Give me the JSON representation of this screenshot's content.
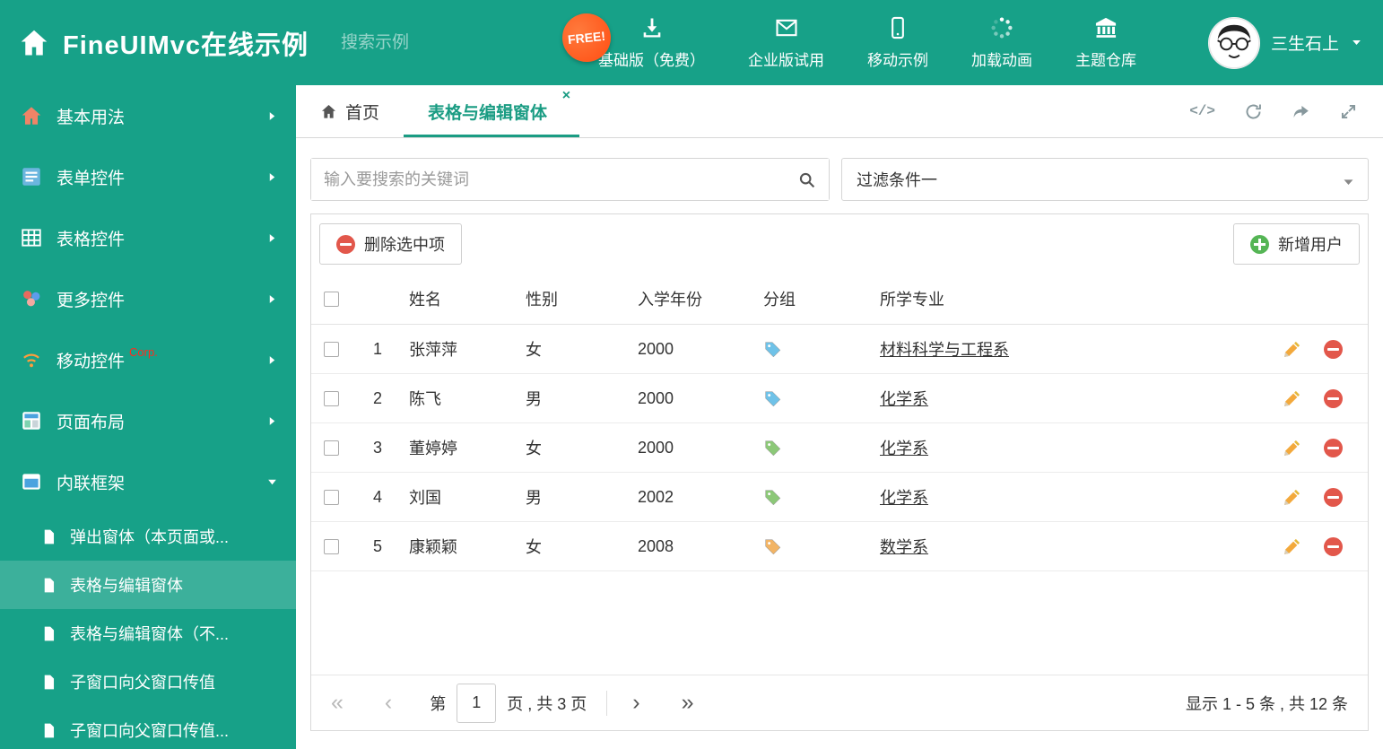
{
  "colors": {
    "accent": "#17a188",
    "badge": "#ff5722",
    "danger": "#e2574b",
    "success": "#55b555",
    "edit": "#f0a63c"
  },
  "header": {
    "title": "FineUIMvc在线示例",
    "search_placeholder": "搜索示例",
    "free_badge": "FREE!",
    "nav": [
      {
        "label": "基础版（免费）",
        "icon": "download-icon"
      },
      {
        "label": "企业版试用",
        "icon": "envelope-icon"
      },
      {
        "label": "移动示例",
        "icon": "mobile-icon"
      },
      {
        "label": "加载动画",
        "icon": "spinner-icon"
      },
      {
        "label": "主题仓库",
        "icon": "bank-icon"
      }
    ],
    "user": {
      "name": "三生石上"
    }
  },
  "sidebar": {
    "items": [
      {
        "label": "基本用法",
        "icon": "home-icon"
      },
      {
        "label": "表单控件",
        "icon": "form-icon"
      },
      {
        "label": "表格控件",
        "icon": "table-icon"
      },
      {
        "label": "更多控件",
        "icon": "widgets-icon"
      },
      {
        "label": "移动控件",
        "badge": "Corp.",
        "icon": "wireless-icon"
      },
      {
        "label": "页面布局",
        "icon": "layout-icon"
      },
      {
        "label": "内联框架",
        "icon": "iframe-icon"
      }
    ],
    "subitems": [
      {
        "label": "弹出窗体（本页面或..."
      },
      {
        "label": "表格与编辑窗体"
      },
      {
        "label": "表格与编辑窗体（不..."
      },
      {
        "label": "子窗口向父窗口传值"
      },
      {
        "label": "子窗口向父窗口传值..."
      }
    ]
  },
  "tabs": {
    "home": "首页",
    "active": "表格与编辑窗体"
  },
  "filter": {
    "search_placeholder": "输入要搜索的关键词",
    "dropdown_value": "过滤条件一"
  },
  "toolbar": {
    "delete_label": "删除选中项",
    "add_label": "新增用户"
  },
  "table": {
    "headers": {
      "name": "姓名",
      "gender": "性别",
      "year": "入学年份",
      "group": "分组",
      "major": "所学专业"
    },
    "rows": [
      {
        "index": "1",
        "name": "张萍萍",
        "gender": "女",
        "year": "2000",
        "tag_color": "#6fc2e8",
        "major": "材料科学与工程系"
      },
      {
        "index": "2",
        "name": "陈飞",
        "gender": "男",
        "year": "2000",
        "tag_color": "#6fc2e8",
        "major": "化学系"
      },
      {
        "index": "3",
        "name": "董婷婷",
        "gender": "女",
        "year": "2000",
        "tag_color": "#8cc878",
        "major": "化学系"
      },
      {
        "index": "4",
        "name": "刘国",
        "gender": "男",
        "year": "2002",
        "tag_color": "#8cc878",
        "major": "化学系"
      },
      {
        "index": "5",
        "name": "康颖颖",
        "gender": "女",
        "year": "2008",
        "tag_color": "#f2b465",
        "major": "数学系"
      }
    ]
  },
  "pagination": {
    "page_prefix": "第",
    "current_page": "1",
    "page_suffix": "页 , 共 3 页",
    "summary": "显示 1 - 5 条 , 共 12 条"
  }
}
